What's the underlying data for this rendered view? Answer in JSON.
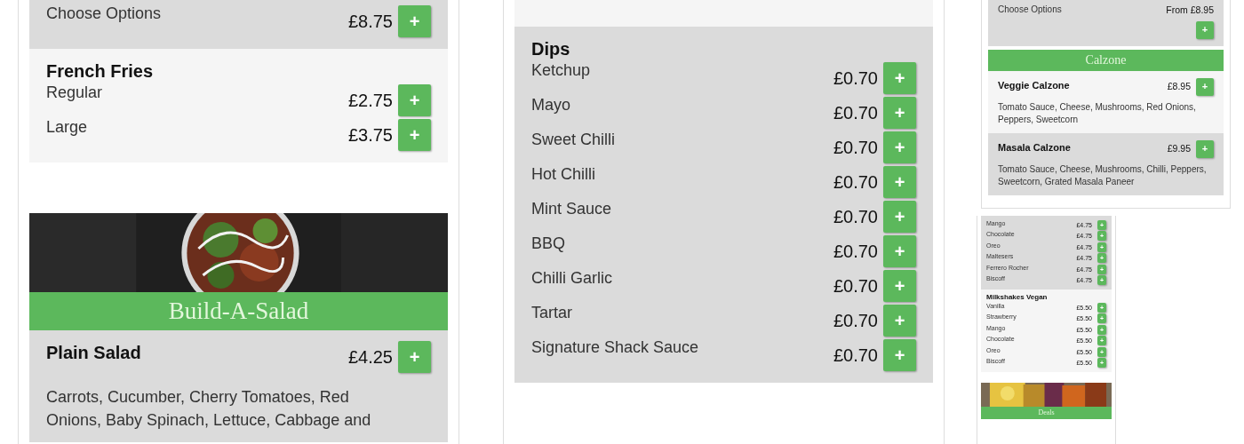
{
  "columns": [
    {
      "blocks": [
        {
          "kind": "shaded",
          "options": [
            {
              "label": "Choose Options",
              "price": "£8.75",
              "button": "+"
            }
          ]
        },
        {
          "kind": "plain",
          "title": "French Fries",
          "options": [
            {
              "label": "Regular",
              "price": "£2.75",
              "button": "+"
            },
            {
              "label": "Large",
              "price": "£3.75",
              "button": "+"
            }
          ]
        },
        {
          "kind": "picture"
        },
        {
          "kind": "banner",
          "text": "Build-A-Salad"
        },
        {
          "kind": "shaded",
          "title": "Plain Salad",
          "price": "£4.25",
          "button": "+",
          "description": "Carrots, Cucumber, Cherry Tomatoes, Red Onions, Baby Spinach, Lettuce, Cabbage and"
        }
      ]
    },
    {
      "blocks": [
        {
          "kind": "plain"
        },
        {
          "kind": "shaded",
          "title": "Dips",
          "options": [
            {
              "label": "Ketchup",
              "price": "£0.70",
              "button": "+"
            },
            {
              "label": "Mayo",
              "price": "£0.70",
              "button": "+"
            },
            {
              "label": "Sweet Chilli",
              "price": "£0.70",
              "button": "+"
            },
            {
              "label": "Hot Chilli",
              "price": "£0.70",
              "button": "+"
            },
            {
              "label": "Mint Sauce",
              "price": "£0.70",
              "button": "+"
            },
            {
              "label": "BBQ",
              "price": "£0.70",
              "button": "+"
            },
            {
              "label": "Chilli Garlic",
              "price": "£0.70",
              "button": "+"
            },
            {
              "label": "Tartar",
              "price": "£0.70",
              "button": "+"
            },
            {
              "label": "Signature Shack Sauce",
              "price": "£0.70",
              "button": "+"
            }
          ]
        }
      ]
    },
    {
      "blocks": [
        {
          "kind": "shaded",
          "options": [
            {
              "label": "Choose Options",
              "price": "From £8.95",
              "button": "+",
              "button_below": true
            }
          ]
        },
        {
          "kind": "banner",
          "text": "Calzone"
        },
        {
          "kind": "plain",
          "title": "Veggie Calzone",
          "price": "£8.95",
          "button": "+",
          "description": "Tomato Sauce, Cheese, Mushrooms, Red Onions, Peppers, Sweetcorn"
        },
        {
          "kind": "shaded",
          "title": "Masala Calzone",
          "price": "£9.95",
          "button": "+",
          "description": "Tomato Sauce, Cheese, Mushrooms, Chilli, Peppers, Sweetcorn, Grated Masala Paneer"
        }
      ]
    },
    {
      "blocks": [
        {
          "kind": "shaded",
          "options": [
            {
              "label": "Mango",
              "price": "£4.75",
              "button": "+"
            },
            {
              "label": "Chocolate",
              "price": "£4.75",
              "button": "+"
            },
            {
              "label": "Oreo",
              "price": "£4.75",
              "button": "+"
            },
            {
              "label": "Maltesers",
              "price": "£4.75",
              "button": "+"
            },
            {
              "label": "Ferrero Rocher",
              "price": "£4.75",
              "button": "+"
            },
            {
              "label": "Biscoff",
              "price": "£4.75",
              "button": "+"
            }
          ]
        },
        {
          "kind": "plain",
          "title": "Milkshakes Vegan",
          "options": [
            {
              "label": "Vanilla",
              "price": "£5.50",
              "button": "+"
            },
            {
              "label": "Strawberry",
              "price": "£5.50",
              "button": "+"
            },
            {
              "label": "Mango",
              "price": "£5.50",
              "button": "+"
            },
            {
              "label": "Chocolate",
              "price": "£5.50",
              "button": "+"
            },
            {
              "label": "Oreo",
              "price": "£5.50",
              "button": "+"
            },
            {
              "label": "Biscoff",
              "price": "£5.50",
              "button": "+"
            }
          ]
        },
        {
          "kind": "picture"
        },
        {
          "kind": "banner",
          "text": "Deals"
        }
      ]
    }
  ]
}
